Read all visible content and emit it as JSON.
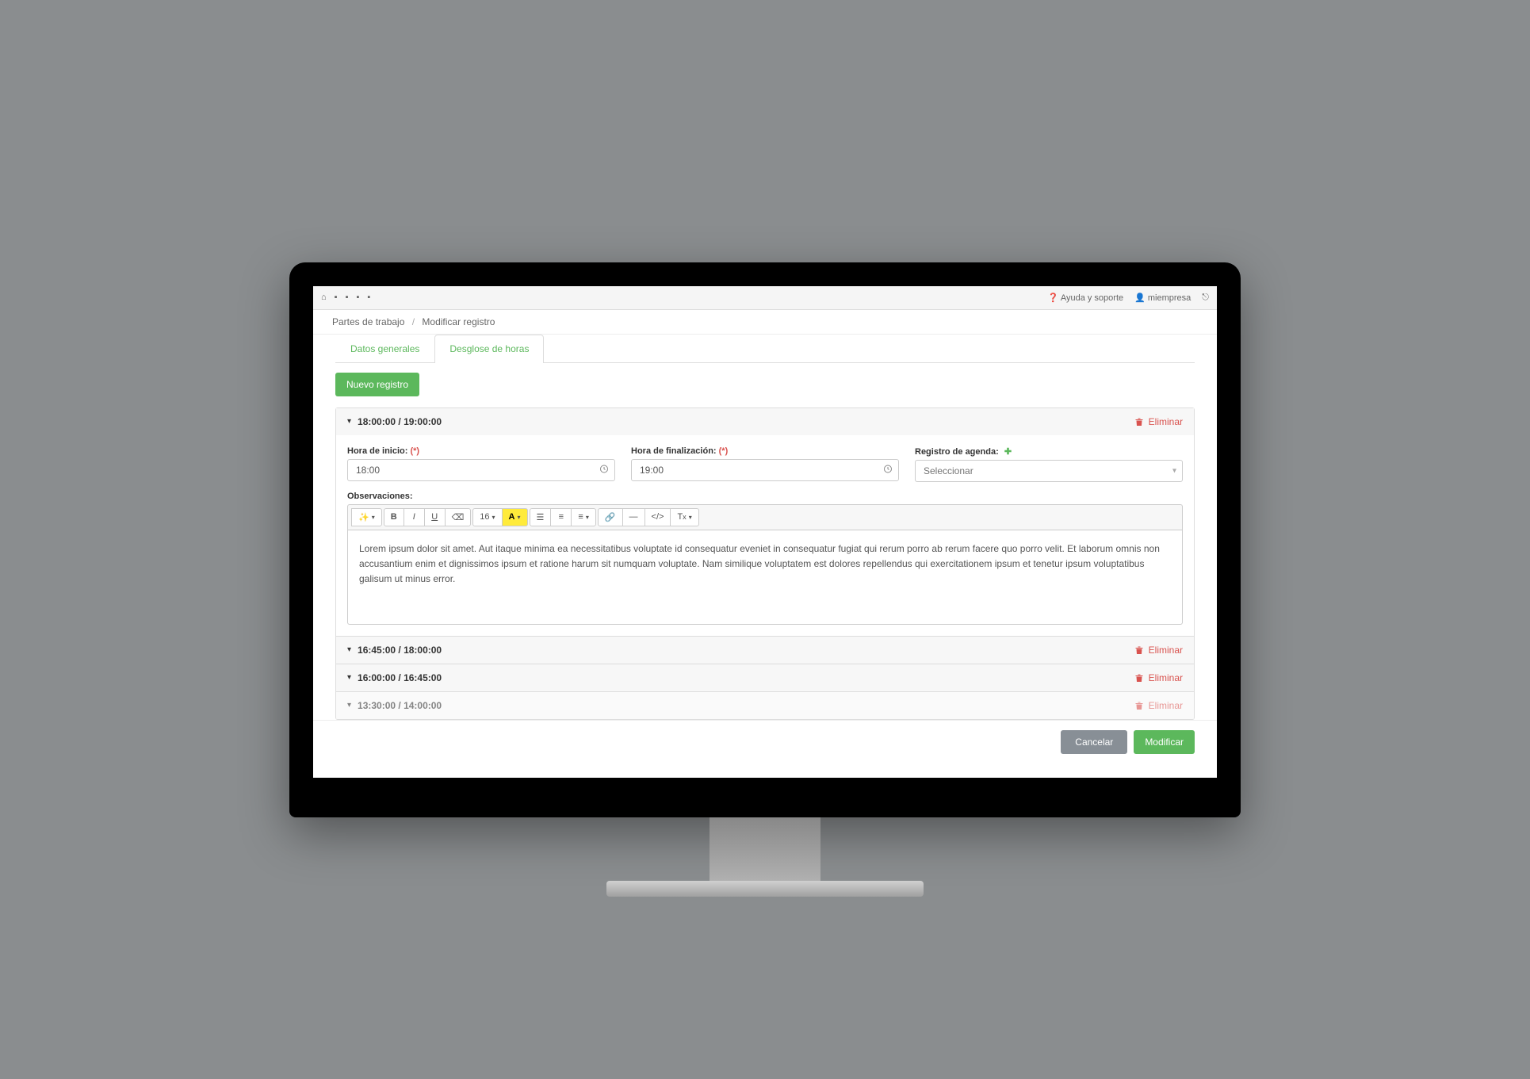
{
  "header": {
    "help_label": "Ayuda y soporte",
    "company_label": "miempresa"
  },
  "breadcrumb": {
    "parent": "Partes de trabajo",
    "current": "Modificar registro"
  },
  "tabs": {
    "general": "Datos generales",
    "breakdown": "Desglose de horas"
  },
  "buttons": {
    "new_record": "Nuevo registro",
    "cancel": "Cancelar",
    "modify": "Modificar",
    "delete": "Eliminar"
  },
  "labels": {
    "start_time": "Hora de inicio:",
    "end_time": "Hora de finalización:",
    "agenda": "Registro de agenda:",
    "required": "(*)",
    "observations": "Observaciones:",
    "select_placeholder": "Seleccionar"
  },
  "editor_toolbar": {
    "fontsize": "16"
  },
  "panels": [
    {
      "title": "18:00:00 / 19:00:00",
      "start": "18:00",
      "end": "19:00",
      "observations": "Lorem ipsum dolor sit amet. Aut itaque minima ea necessitatibus voluptate id consequatur eveniet in consequatur fugiat qui rerum porro ab rerum facere quo porro velit. Et laborum omnis non accusantium enim et dignissimos ipsum et ratione harum sit numquam voluptate. Nam similique voluptatem est dolores repellendus qui exercitationem ipsum et tenetur ipsum voluptatibus galisum ut minus error.",
      "expanded": true
    },
    {
      "title": "16:45:00 / 18:00:00",
      "expanded": false
    },
    {
      "title": "16:00:00 / 16:45:00",
      "expanded": false
    },
    {
      "title": "13:30:00 / 14:00:00",
      "expanded": false
    }
  ]
}
